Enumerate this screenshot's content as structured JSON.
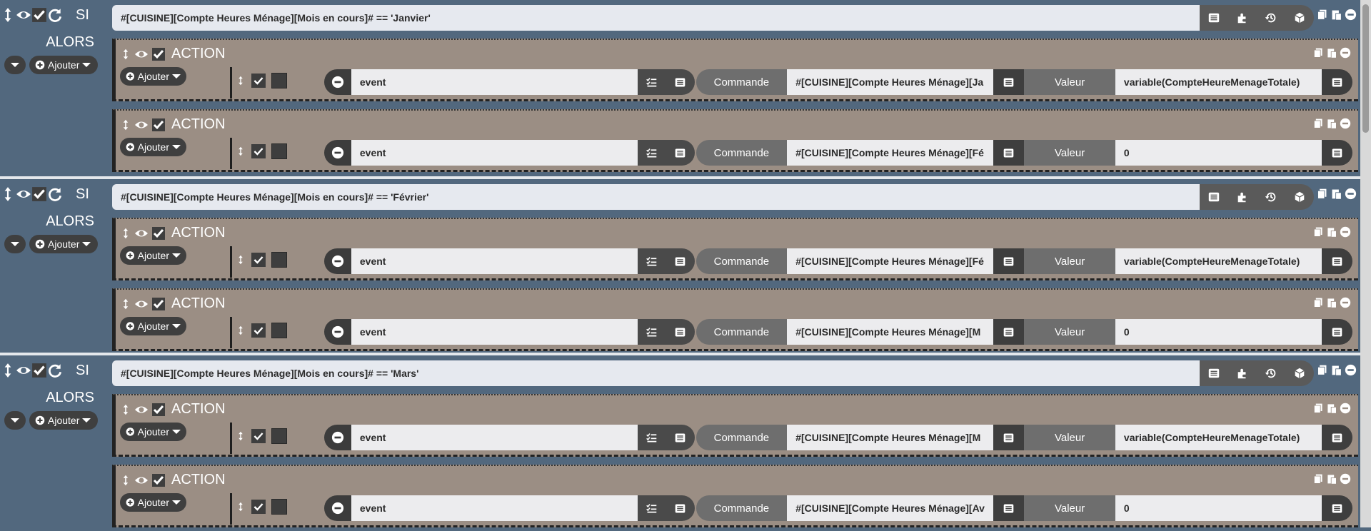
{
  "labels": {
    "si": "SI",
    "alors": "ALORS",
    "ajouter": "Ajouter",
    "action": "ACTION",
    "commande": "Commande",
    "valeur": "Valeur"
  },
  "blocks": [
    {
      "condition": "#[CUISINE][Compte Heures Ménage][Mois en cours]# == 'Janvier'",
      "actions": [
        {
          "event": "event",
          "commande": "#[CUISINE][Compte Heures Ménage][Ja",
          "valeur": "variable(CompteHeureMenageTotale)"
        },
        {
          "event": "event",
          "commande": "#[CUISINE][Compte Heures Ménage][Fé",
          "valeur": "0"
        }
      ]
    },
    {
      "condition": "#[CUISINE][Compte Heures Ménage][Mois en cours]# == 'Février'",
      "actions": [
        {
          "event": "event",
          "commande": "#[CUISINE][Compte Heures Ménage][Fé",
          "valeur": "variable(CompteHeureMenageTotale)"
        },
        {
          "event": "event",
          "commande": "#[CUISINE][Compte Heures Ménage][M",
          "valeur": "0"
        }
      ]
    },
    {
      "condition": "#[CUISINE][Compte Heures Ménage][Mois en cours]# == 'Mars'",
      "actions": [
        {
          "event": "event",
          "commande": "#[CUISINE][Compte Heures Ménage][M",
          "valeur": "variable(CompteHeureMenageTotale)"
        },
        {
          "event": "event",
          "commande": "#[CUISINE][Compte Heures Ménage][Av",
          "valeur": "0"
        }
      ]
    }
  ]
}
